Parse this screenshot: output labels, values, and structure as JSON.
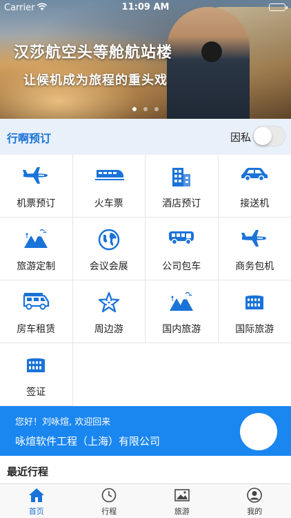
{
  "status_bar": {
    "carrier": "Carrier",
    "time": "11:09 AM"
  },
  "banner": {
    "headline": "汉莎航空头等舱航站楼",
    "subline": "让候机成为旅程的重头戏",
    "page_count": 3,
    "active_page": 1
  },
  "header": {
    "title": "行啊预订",
    "private_label": "因私",
    "private_toggle_on": false
  },
  "services": [
    {
      "label": "机票预订",
      "icon": "airplane-icon"
    },
    {
      "label": "火车票",
      "icon": "train-icon"
    },
    {
      "label": "酒店预订",
      "icon": "hotel-icon"
    },
    {
      "label": "接送机",
      "icon": "car-icon"
    },
    {
      "label": "旅游定制",
      "icon": "mountains-icon"
    },
    {
      "label": "会议会展",
      "icon": "globe-icon"
    },
    {
      "label": "公司包车",
      "icon": "bus-icon"
    },
    {
      "label": "商务包机",
      "icon": "airplane-icon"
    },
    {
      "label": "房车租赁",
      "icon": "rv-icon"
    },
    {
      "label": "周边游",
      "icon": "starfish-icon"
    },
    {
      "label": "国内旅游",
      "icon": "mountains-icon"
    },
    {
      "label": "国际旅游",
      "icon": "colosseum-icon"
    },
    {
      "label": "签证",
      "icon": "colosseum-icon"
    }
  ],
  "welcome": {
    "greeting": "您好！刘咏煊, 欢迎回来",
    "company": "咏煊软件工程（上海）有限公司"
  },
  "recent": {
    "title": "最近行程"
  },
  "tabbar": [
    {
      "label": "首页",
      "icon": "home-icon",
      "active": true
    },
    {
      "label": "行程",
      "icon": "clock-icon",
      "active": false
    },
    {
      "label": "旅游",
      "icon": "picture-icon",
      "active": false
    },
    {
      "label": "我的",
      "icon": "user-icon",
      "active": false
    }
  ],
  "colors": {
    "accent": "#1a73d8",
    "welcome_bg": "#1a86f0",
    "header_bg": "#e8f0fa"
  }
}
